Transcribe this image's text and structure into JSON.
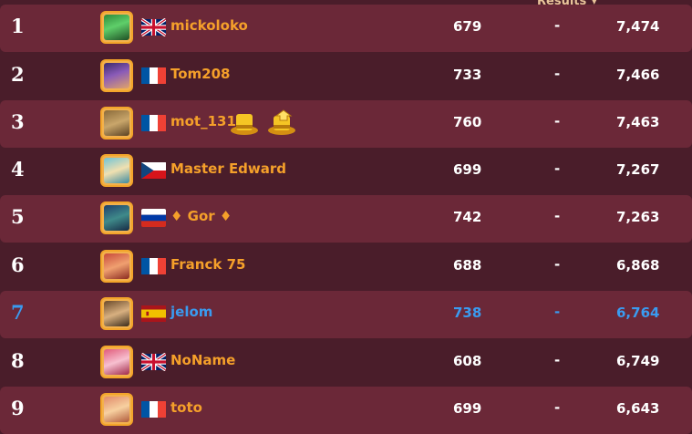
{
  "header": {
    "results_label": "Results",
    "sort_icon": "chevron-down-icon"
  },
  "colors": {
    "background": "#4a1d2a",
    "row_alt": "#6b2838",
    "name_orange": "#f5a02a",
    "highlight_blue": "#3a9bf0",
    "avatar_border": "#f3a52a"
  },
  "rows": [
    {
      "rank": "1",
      "flag": "uk",
      "name": "mickoloko",
      "score": "679",
      "dash": "-",
      "total": "7,474"
    },
    {
      "rank": "2",
      "flag": "france",
      "name": "Tom208",
      "score": "733",
      "dash": "-",
      "total": "7,466"
    },
    {
      "rank": "3",
      "flag": "france",
      "name": "mot_131",
      "score": "760",
      "dash": "-",
      "total": "7,463",
      "badges": [
        "gold-top-hat-icon",
        "gold-top-hat-upgrade-icon"
      ]
    },
    {
      "rank": "4",
      "flag": "czech",
      "name": "Master Edward",
      "score": "699",
      "dash": "-",
      "total": "7,267"
    },
    {
      "rank": "5",
      "flag": "russia",
      "name": "♦ Gor ♦",
      "score": "742",
      "dash": "-",
      "total": "7,263"
    },
    {
      "rank": "6",
      "flag": "france",
      "name": "Franck 75",
      "score": "688",
      "dash": "-",
      "total": "6,868"
    },
    {
      "rank": "7",
      "flag": "spain",
      "name": "jelom",
      "score": "738",
      "dash": "-",
      "total": "6,764",
      "current_user": true
    },
    {
      "rank": "8",
      "flag": "uk",
      "name": "NoName",
      "score": "608",
      "dash": "-",
      "total": "6,749"
    },
    {
      "rank": "9",
      "flag": "france",
      "name": "toto",
      "score": "699",
      "dash": "-",
      "total": "6,643"
    }
  ]
}
